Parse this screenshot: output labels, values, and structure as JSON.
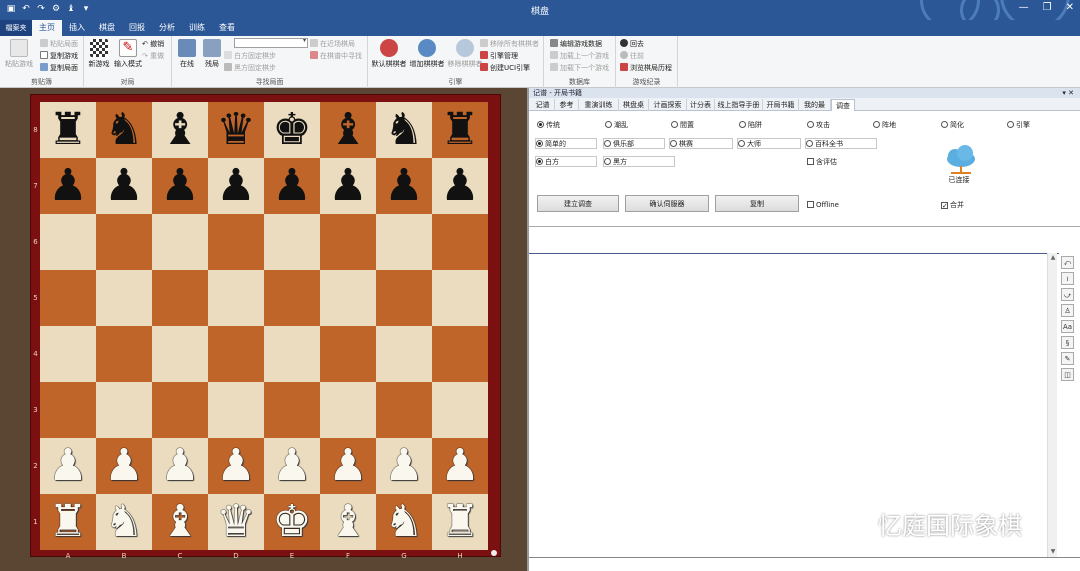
{
  "window": {
    "title": "棋盘",
    "min_icon": "minimize-icon",
    "max_icon": "restore-icon",
    "close_icon": "close-icon"
  },
  "ribbon_tabs": [
    "檔案夹",
    "主页",
    "插入",
    "棋盘",
    "回报",
    "分析",
    "训练",
    "查看"
  ],
  "ribbon": {
    "clipboard": {
      "label": "剪贴簿",
      "paste": "粘贴游戏",
      "paste_pos": "粘贴局面",
      "copy_game": "复制游戏",
      "copy_pos": "复制局面"
    },
    "game": {
      "label": "对局",
      "new_game": "新游戏",
      "input_mode": "输入模式",
      "undo": "撤销",
      "redo": "重做"
    },
    "find_pos": {
      "label": "寻找局面",
      "online": "在线",
      "endgame": "残局",
      "opening_ref": "白方固定棋步",
      "opening_ref2": "黑方固定棋步",
      "db_game": "在近场棋局",
      "db_search": "在棋谱中寻找"
    },
    "engine": {
      "label": "引擎",
      "default_engine": "默认棋棋者",
      "add_engine": "增加棋棋者",
      "remove_engine": "移除棋棋者",
      "remove_all": "移除所有棋棋者",
      "engine_mgmt": "引擎管理",
      "create_uci": "创建UCI引擎"
    },
    "ref_db": {
      "label": "数据库",
      "edit_ref": "编辑游戏数据",
      "load_prev": "加载上一个游戏",
      "load_next": "加载下一个游戏"
    },
    "history": {
      "label": "游戏纪录",
      "back": "回去",
      "forward": "往前",
      "browse": "浏览棋局历程"
    }
  },
  "board": {
    "ranks": [
      "8",
      "7",
      "6",
      "5",
      "4",
      "3",
      "2",
      "1"
    ],
    "files": [
      "A",
      "B",
      "C",
      "D",
      "E",
      "F",
      "G",
      "H"
    ],
    "position": [
      [
        "bR",
        "bN",
        "bB",
        "bQ",
        "bK",
        "bB",
        "bN",
        "bR"
      ],
      [
        "bP",
        "bP",
        "bP",
        "bP",
        "bP",
        "bP",
        "bP",
        "bP"
      ],
      [
        "",
        "",
        "",
        "",
        "",
        "",
        "",
        ""
      ],
      [
        "",
        "",
        "",
        "",
        "",
        "",
        "",
        ""
      ],
      [
        "",
        "",
        "",
        "",
        "",
        "",
        "",
        ""
      ],
      [
        "",
        "",
        "",
        "",
        "",
        "",
        "",
        ""
      ],
      [
        "wP",
        "wP",
        "wP",
        "wP",
        "wP",
        "wP",
        "wP",
        "wP"
      ],
      [
        "wR",
        "wN",
        "wB",
        "wQ",
        "wK",
        "wB",
        "wN",
        "wR"
      ]
    ]
  },
  "panel": {
    "header": "记谱 - 开局书籍",
    "header_ctl": "▾ ✕",
    "tabs": [
      "记谱",
      "参考",
      "重演训练",
      "棋盘桌",
      "计画探索者",
      "计分表",
      "线上指导手册",
      "开局书籍",
      "我的最爱",
      "调查"
    ],
    "active_tab": "调查",
    "search": {
      "row1": [
        "传统",
        "潮乱",
        "間置",
        "陷阱",
        "攻击",
        "阵地",
        "简化",
        "引擎"
      ],
      "row2": [
        "简单的",
        "俱乐部",
        "棋赛",
        "大师",
        "百科全书"
      ],
      "row3": [
        "白方",
        "黑方"
      ],
      "include_eval": "含评估",
      "create_btn": "建立调查",
      "confirm_btn": "确认伺服器",
      "copy_btn": "复制",
      "offline": "Offline",
      "merge": "合并",
      "connected": "已连接"
    }
  },
  "watermark": "忆庭国际象棋"
}
